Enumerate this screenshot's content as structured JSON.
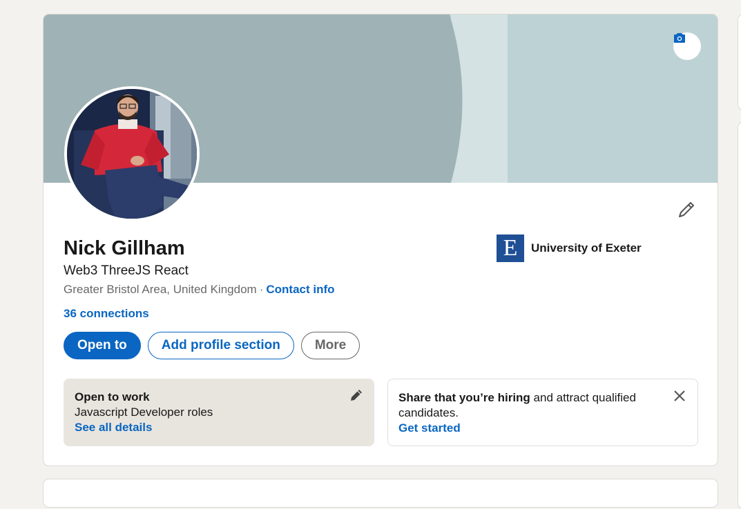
{
  "profile": {
    "name": "Nick Gillham",
    "headline": "Web3 ThreeJS React",
    "location": "Greater Bristol Area, United Kingdom",
    "separator": "·",
    "contact_info": "Contact info",
    "connections": "36 connections"
  },
  "school": {
    "logo_letter": "E",
    "name": "University of Exeter"
  },
  "actions": {
    "open_to": "Open to",
    "add_section": "Add profile section",
    "more": "More"
  },
  "open_to_work": {
    "title": "Open to work",
    "roles": "Javascript Developer roles",
    "link": "See all details"
  },
  "hiring": {
    "title_bold": "Share that you’re hiring",
    "title_rest": " and attract qualified candidates.",
    "link": "Get started"
  },
  "icons": {
    "camera": "camera-icon",
    "edit": "pencil-icon",
    "close": "close-icon"
  },
  "colors": {
    "accent": "#0a66c2",
    "banner": "#bdd2d4",
    "page_bg": "#f4f2ee",
    "open_to_work_bg": "#e8e5df"
  }
}
